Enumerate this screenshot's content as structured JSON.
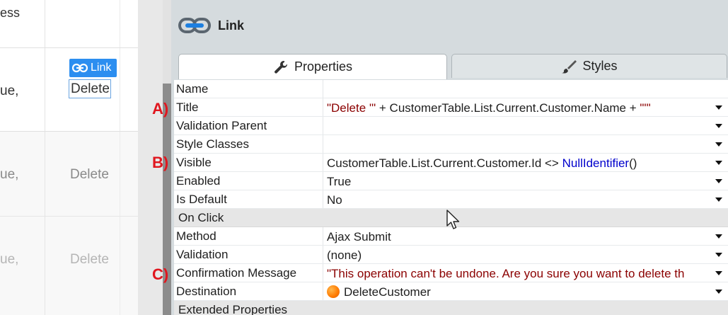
{
  "canvas": {
    "header_fragment": "ess",
    "rows": [
      {
        "fragment": "ue,",
        "link_label": "Link",
        "delete_label": "Delete"
      },
      {
        "fragment": "ue,",
        "delete_label": "Delete"
      },
      {
        "fragment": "ue,",
        "delete_label": "Delete"
      }
    ]
  },
  "panel": {
    "title": "Link",
    "tabs": {
      "properties": "Properties",
      "styles": "Styles"
    }
  },
  "properties": {
    "name": {
      "label": "Name",
      "value": ""
    },
    "title": {
      "label": "Title",
      "value_str1": "\"Delete '\"",
      "value_mid": " + CustomerTable.List.Current.Customer.Name + ",
      "value_str2": "\"'\""
    },
    "validation_parent": {
      "label": "Validation Parent",
      "value": ""
    },
    "style_classes": {
      "label": "Style Classes",
      "value": ""
    },
    "visible": {
      "label": "Visible",
      "value_plain": "CustomerTable.List.Current.Customer.Id <> ",
      "value_func": "NullIdentifier",
      "value_tail": "()"
    },
    "enabled": {
      "label": "Enabled",
      "value": "True"
    },
    "is_default": {
      "label": "Is Default",
      "value": "No"
    },
    "on_click_section": "On Click",
    "method": {
      "label": "Method",
      "value": "Ajax Submit"
    },
    "validation": {
      "label": "Validation",
      "value": "(none)"
    },
    "confirmation": {
      "label": "Confirmation Message",
      "value": "\"This operation can't be undone. Are you sure you want to delete th"
    },
    "destination": {
      "label": "Destination",
      "value": "DeleteCustomer"
    },
    "extended_section": "Extended Properties"
  },
  "markers": {
    "a": "A)",
    "b": "B)",
    "c": "C)"
  },
  "colors": {
    "accent": "#2c8ef0",
    "marker": "#e0161e",
    "string": "#8b0000",
    "keyword": "#0000cc"
  }
}
